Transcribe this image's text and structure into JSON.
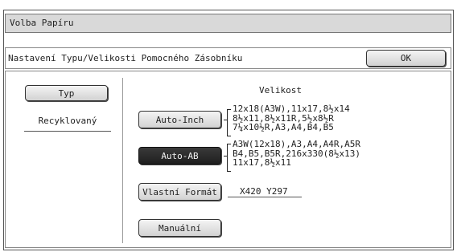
{
  "window": {
    "title": "Volba Papíru"
  },
  "header": {
    "subtitle": "Nastavení Typu/Velikosti Pomocného Zásobníku",
    "ok_label": "OK"
  },
  "left": {
    "type_button": "Typ",
    "current_type": "Recyklovaný"
  },
  "right": {
    "heading": "Velikost",
    "auto_inch": {
      "label": "Auto-Inch",
      "sizes": [
        "12x18(A3W),11x17,8½x14",
        "8½x11,8½x11R,5½x8½R",
        "7¼x10½R,A3,A4,B4,B5"
      ]
    },
    "auto_ab": {
      "label": "Auto-AB",
      "selected": true,
      "sizes": [
        "A3W(12x18),A3,A4,A4R,A5R",
        "B4,B5,B5R,216x330(8½x13)",
        "11x17,8½x11"
      ]
    },
    "custom": {
      "label": "Vlastní Formát",
      "value": "X420  Y297"
    },
    "manual": {
      "label": "Manuální"
    }
  },
  "colors": {
    "selected_bg": "#2b2b2b",
    "titlebar_bg": "#d9d9d9"
  }
}
